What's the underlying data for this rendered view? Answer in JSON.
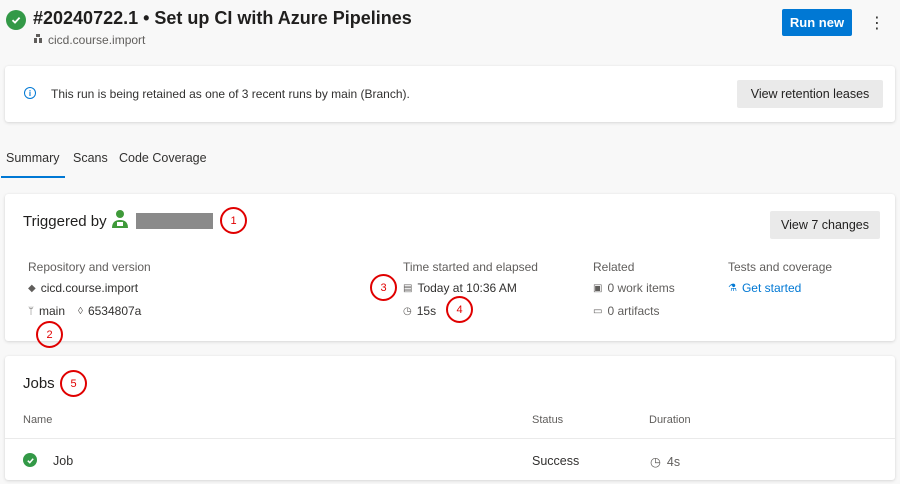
{
  "header": {
    "run_title": "#20240722.1 • Set up CI with Azure Pipelines",
    "pipeline_name": "cicd.course.import",
    "run_new_label": "Run new",
    "more_label": "⋮"
  },
  "banner": {
    "message": "This run is being retained as one of 3 recent runs by main (Branch).",
    "button_label": "View retention leases"
  },
  "tabs": [
    {
      "label": "Summary",
      "active": true
    },
    {
      "label": "Scans",
      "active": false
    },
    {
      "label": "Code Coverage",
      "active": false
    }
  ],
  "summary": {
    "triggered_by_label": "Triggered by",
    "view_changes_label": "View 7 changes",
    "repo_label": "Repository and version",
    "repo_name": "cicd.course.import",
    "branch": "main",
    "commit": "6534807a",
    "time_label": "Time started and elapsed",
    "started": "Today at 10:36 AM",
    "elapsed": "15s",
    "related_label": "Related",
    "work_items": "0 work items",
    "artifacts": "0 artifacts",
    "tests_label": "Tests and coverage",
    "tests_link": "Get started"
  },
  "jobs": {
    "title": "Jobs",
    "columns": {
      "name": "Name",
      "status": "Status",
      "duration": "Duration"
    },
    "rows": [
      {
        "name": "Job",
        "status": "Success",
        "duration": "4s"
      }
    ]
  },
  "annotations": [
    "1",
    "2",
    "3",
    "4",
    "5"
  ],
  "colors": {
    "accent": "#0078d4",
    "success": "#339947",
    "annotation": "#e00000"
  }
}
